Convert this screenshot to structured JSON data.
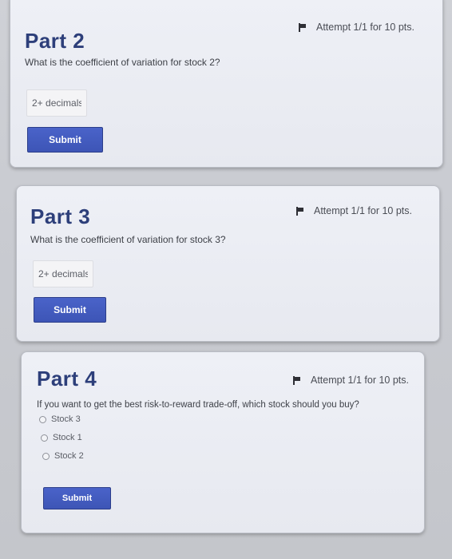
{
  "parts": [
    {
      "title": "Part 2",
      "attempt": "Attempt 1/1 for 10 pts.",
      "question": "What is the coefficient of variation for stock 2?",
      "input_placeholder": "2+ decimals",
      "submit_label": "Submit"
    },
    {
      "title": "Part 3",
      "attempt": "Attempt 1/1 for 10 pts.",
      "question": "What is the coefficient of variation for stock 3?",
      "input_placeholder": "2+ decimals",
      "submit_label": "Submit"
    },
    {
      "title": "Part 4",
      "attempt": "Attempt 1/1 for 10 pts.",
      "question": "If you want to get the best risk-to-reward trade-off, which stock should you buy?",
      "options": [
        "Stock 3",
        "Stock 1",
        "Stock 2"
      ],
      "submit_label": "Submit"
    }
  ]
}
